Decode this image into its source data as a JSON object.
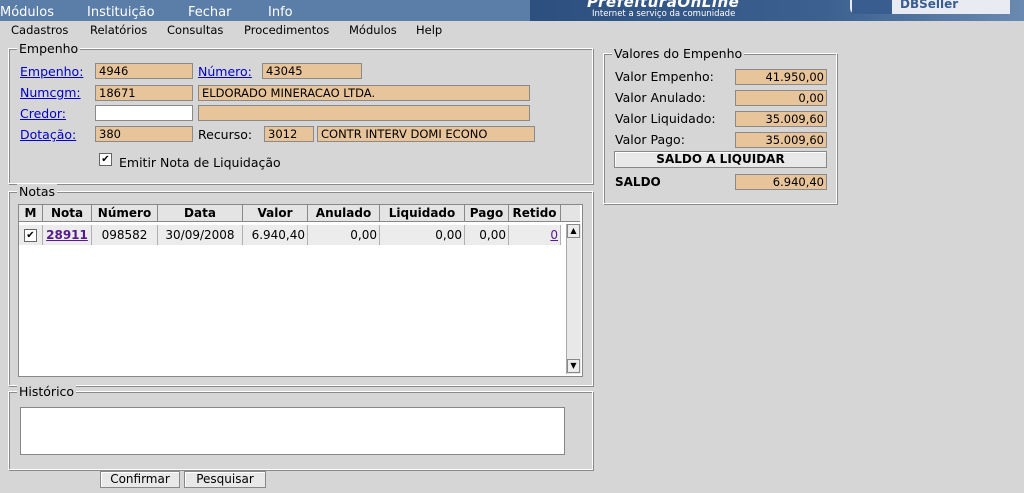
{
  "topmenu": [
    "Módulos",
    "Instituição",
    "Fechar",
    "Info"
  ],
  "banner": {
    "title": "PrefeituraOnLine",
    "subtitle": "Internet a serviço da comunidade",
    "brand": "DBSeller"
  },
  "menubar": [
    "Cadastros",
    "Relatórios",
    "Consultas",
    "Procedimentos",
    "Módulos",
    "Help"
  ],
  "empenho": {
    "legend": "Empenho",
    "empenho_label": "Empenho:",
    "empenho_value": "4946",
    "numero_label": "Número:",
    "numero_value": "43045",
    "numcgm_label": "Numcgm:",
    "numcgm_value": "18671",
    "numcgm_name": "ELDORADO MINERACAO LTDA.",
    "credor_label": "Credor:",
    "credor_value": "",
    "credor_name": "",
    "dotacao_label": "Dotação:",
    "dotacao_value": "380",
    "recurso_label": "Recurso:",
    "recurso_value": "3012",
    "recurso_name": "CONTR INTERV DOMI ECONO",
    "emitir_label": "Emitir Nota de Liquidação",
    "emitir_checked": "✔"
  },
  "valores": {
    "legend": "Valores do Empenho",
    "rows": [
      {
        "label": "Valor Empenho:",
        "value": "41.950,00"
      },
      {
        "label": "Valor Anulado:",
        "value": "0,00"
      },
      {
        "label": "Valor Liquidado:",
        "value": "35.009,60"
      },
      {
        "label": "Valor Pago:",
        "value": "35.009,60"
      }
    ],
    "saldo_button": "SALDO A LIQUIDAR",
    "saldo_label": "SALDO",
    "saldo_value": "6.940,40"
  },
  "notas": {
    "legend": "Notas",
    "columns": [
      "M",
      "Nota",
      "Número",
      "Data",
      "Valor",
      "Anulado",
      "Liquidado",
      "Pago",
      "Retido"
    ],
    "rows": [
      {
        "m": "✔",
        "nota": "28911",
        "numero": "098582",
        "data": "30/09/2008",
        "valor": "6.940,40",
        "anulado": "0,00",
        "liquidado": "0,00",
        "pago": "0,00",
        "retido": "0"
      }
    ]
  },
  "historico": {
    "legend": "Histórico",
    "value": ""
  },
  "buttons": {
    "confirmar": "Confirmar",
    "pesquisar": "Pesquisar"
  },
  "colors": {
    "topbar": "#5a7ea8",
    "field": "#e8c49a",
    "background": "#d6d6d6",
    "link": "#0000c8"
  }
}
